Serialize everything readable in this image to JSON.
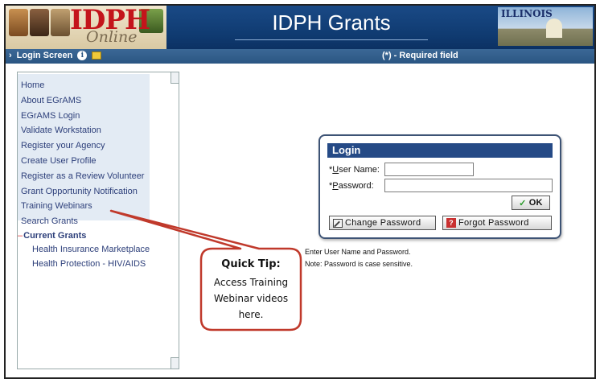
{
  "header": {
    "logo_text": "IDPH",
    "logo_subtext": "Online",
    "app_title": "IDPH Grants",
    "state_logo_text": "ILLINOIS"
  },
  "navbar": {
    "screen_label": "Login Screen",
    "required_note": "(*) - Required field"
  },
  "sidebar": {
    "items": [
      {
        "label": "Home"
      },
      {
        "label": "About EGrAMS"
      },
      {
        "label": "EGrAMS Login"
      },
      {
        "label": "Validate Workstation"
      },
      {
        "label": "Register your Agency"
      },
      {
        "label": "Create User Profile"
      },
      {
        "label": "Register as a Review Volunteer"
      },
      {
        "label": "Grant Opportunity Notification"
      },
      {
        "label": "Training Webinars"
      },
      {
        "label": "Search Grants"
      }
    ],
    "current_grants_label": "Current Grants",
    "grants": [
      {
        "label": "Health Insurance Marketplace"
      },
      {
        "label": "Health Protection - HIV/AIDS"
      }
    ]
  },
  "login": {
    "title": "Login",
    "user_label_prefix": "*",
    "user_label_hotkey": "U",
    "user_label_rest": "ser Name:",
    "pass_label_prefix": "*",
    "pass_label_hotkey": "P",
    "pass_label_rest": "assword:",
    "user_value": "",
    "pass_value": "",
    "ok_label": "OK",
    "change_password_label": "Change Password",
    "forgot_password_label": "Forgot Password",
    "note_line1": "Enter User Name and Password.",
    "note_line2": "Note: Password is case sensitive."
  },
  "tip": {
    "title": "Quick Tip:",
    "body": "Access Training Webinar videos here."
  },
  "colors": {
    "header_blue": "#0f3a70",
    "navbar_blue": "#2a5582",
    "login_header": "#254a86",
    "callout_red": "#c0392b",
    "menu_text": "#2d3f7a"
  }
}
